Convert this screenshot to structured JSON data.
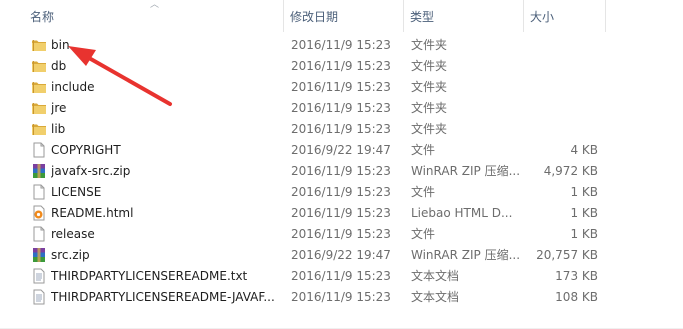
{
  "columns": {
    "name": "名称",
    "date": "修改日期",
    "type": "类型",
    "size": "大小"
  },
  "files": [
    {
      "name": "bin",
      "date": "2016/11/9 15:23",
      "type": "文件夹",
      "size": "",
      "icon": "folder-icon"
    },
    {
      "name": "db",
      "date": "2016/11/9 15:23",
      "type": "文件夹",
      "size": "",
      "icon": "folder-icon"
    },
    {
      "name": "include",
      "date": "2016/11/9 15:23",
      "type": "文件夹",
      "size": "",
      "icon": "folder-icon"
    },
    {
      "name": "jre",
      "date": "2016/11/9 15:23",
      "type": "文件夹",
      "size": "",
      "icon": "folder-icon"
    },
    {
      "name": "lib",
      "date": "2016/11/9 15:23",
      "type": "文件夹",
      "size": "",
      "icon": "folder-icon"
    },
    {
      "name": "COPYRIGHT",
      "date": "2016/9/22 19:47",
      "type": "文件",
      "size": "4 KB",
      "icon": "file-icon"
    },
    {
      "name": "javafx-src.zip",
      "date": "2016/11/9 15:23",
      "type": "WinRAR ZIP 压缩...",
      "size": "4,972 KB",
      "icon": "winrar-archive-icon"
    },
    {
      "name": "LICENSE",
      "date": "2016/11/9 15:23",
      "type": "文件",
      "size": "1 KB",
      "icon": "file-icon"
    },
    {
      "name": "README.html",
      "date": "2016/11/9 15:23",
      "type": "Liebao HTML D...",
      "size": "1 KB",
      "icon": "html-document-icon"
    },
    {
      "name": "release",
      "date": "2016/11/9 15:23",
      "type": "文件",
      "size": "1 KB",
      "icon": "file-icon"
    },
    {
      "name": "src.zip",
      "date": "2016/9/22 19:47",
      "type": "WinRAR ZIP 压缩...",
      "size": "20,757 KB",
      "icon": "winrar-archive-icon"
    },
    {
      "name": "THIRDPARTYLICENSEREADME.txt",
      "date": "2016/11/9 15:23",
      "type": "文本文档",
      "size": "173 KB",
      "icon": "text-document-icon"
    },
    {
      "name": "THIRDPARTYLICENSEREADME-JAVAF...",
      "date": "2016/11/9 15:23",
      "type": "文本文档",
      "size": "108 KB",
      "icon": "text-document-icon"
    }
  ],
  "annotation": {
    "arrow_color": "#e8332f",
    "points_to": "bin"
  },
  "colors": {
    "folder": "#e8c15a",
    "header_text": "#4c607a",
    "secondary_text": "#6d6d6d"
  }
}
